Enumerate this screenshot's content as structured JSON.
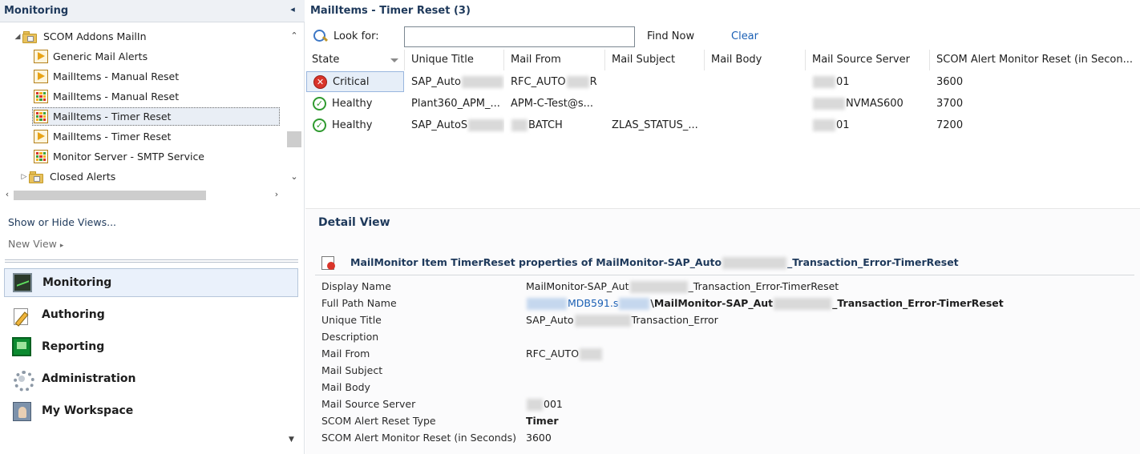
{
  "left": {
    "title": "Monitoring",
    "tree": [
      {
        "label": "SCOM Addons MailIn",
        "icon": "folder-icon"
      },
      {
        "label": "Generic Mail Alerts",
        "icon": "alert-view-icon"
      },
      {
        "label": "MailItems - Manual Reset",
        "icon": "alert-view-icon"
      },
      {
        "label": "MailItems - Manual Reset",
        "icon": "state-view-icon"
      },
      {
        "label": "MailItems - Timer Reset",
        "icon": "state-view-icon"
      },
      {
        "label": "MailItems - Timer Reset",
        "icon": "alert-view-icon"
      },
      {
        "label": "Monitor Server - SMTP Service",
        "icon": "state-view-icon"
      },
      {
        "label": "Closed Alerts",
        "icon": "folder-icon"
      }
    ],
    "show_hide": "Show or Hide Views...",
    "new_view": "New View",
    "wunderbar": [
      "Monitoring",
      "Authoring",
      "Reporting",
      "Administration",
      "My Workspace"
    ]
  },
  "results": {
    "title": "MailItems - Timer Reset (3)",
    "look_for": "Look for:",
    "search_value": "",
    "find_now": "Find Now",
    "clear": "Clear",
    "columns": [
      "State",
      "Unique Title",
      "Mail From",
      "Mail Subject",
      "Mail Body",
      "Mail Source Server",
      "SCOM Alert Monitor Reset (in Secon..."
    ],
    "rows": [
      {
        "state": "Critical",
        "title_a": "SAP_Auto",
        "title_b": ".",
        "from_a": "RFC_AUTO",
        "from_b": "R",
        "subject": "",
        "body": "",
        "server": "01",
        "reset": "3600"
      },
      {
        "state": "Healthy",
        "title_a": "Plant360_APM_...",
        "title_b": "",
        "from_a": "APM-C-Test@s...",
        "from_b": "",
        "subject": "",
        "body": "",
        "server": "NVMAS600",
        "reset": "3700"
      },
      {
        "state": "Healthy",
        "title_a": "SAP_AutoS",
        "title_b": "",
        "from_a": "BATCH",
        "from_b": "",
        "subject": "ZLAS_STATUS_...",
        "body": "",
        "server": "01",
        "reset": "7200"
      }
    ]
  },
  "detail": {
    "title": "Detail View",
    "heading_a": "MailMonitor Item TimerReset properties of MailMonitor-SAP_Auto",
    "heading_b": "_Transaction_Error-TimerReset",
    "props": [
      {
        "name": "Display Name",
        "value_a": "MailMonitor-SAP_Aut",
        "value_b": "_Transaction_Error-TimerReset"
      },
      {
        "name": "Full Path Name",
        "value_link": "MDB591.s",
        "value_a": "\\MailMonitor-SAP_Aut",
        "value_b": "_Transaction_Error-TimerReset"
      },
      {
        "name": "Unique Title",
        "value_a": "SAP_Auto",
        "value_b": "Transaction_Error"
      },
      {
        "name": "Description",
        "value_a": "",
        "value_b": ""
      },
      {
        "name": "Mail From",
        "value_a": "RFC_AUTO",
        "value_b": ""
      },
      {
        "name": "Mail Subject",
        "value_a": "",
        "value_b": ""
      },
      {
        "name": "Mail Body",
        "value_a": "",
        "value_b": ""
      },
      {
        "name": "Mail Source Server",
        "value_a": "001",
        "value_b": ""
      },
      {
        "name": "SCOM Alert Reset Type",
        "value_a": "Timer",
        "value_b": ""
      },
      {
        "name": "SCOM Alert Monitor Reset (in Seconds)",
        "value_a": "3600",
        "value_b": ""
      }
    ]
  },
  "colors": {
    "accent": "#1e395b",
    "link": "#1a5fb4",
    "critical": "#d9342a",
    "healthy": "#2f9a2f"
  }
}
